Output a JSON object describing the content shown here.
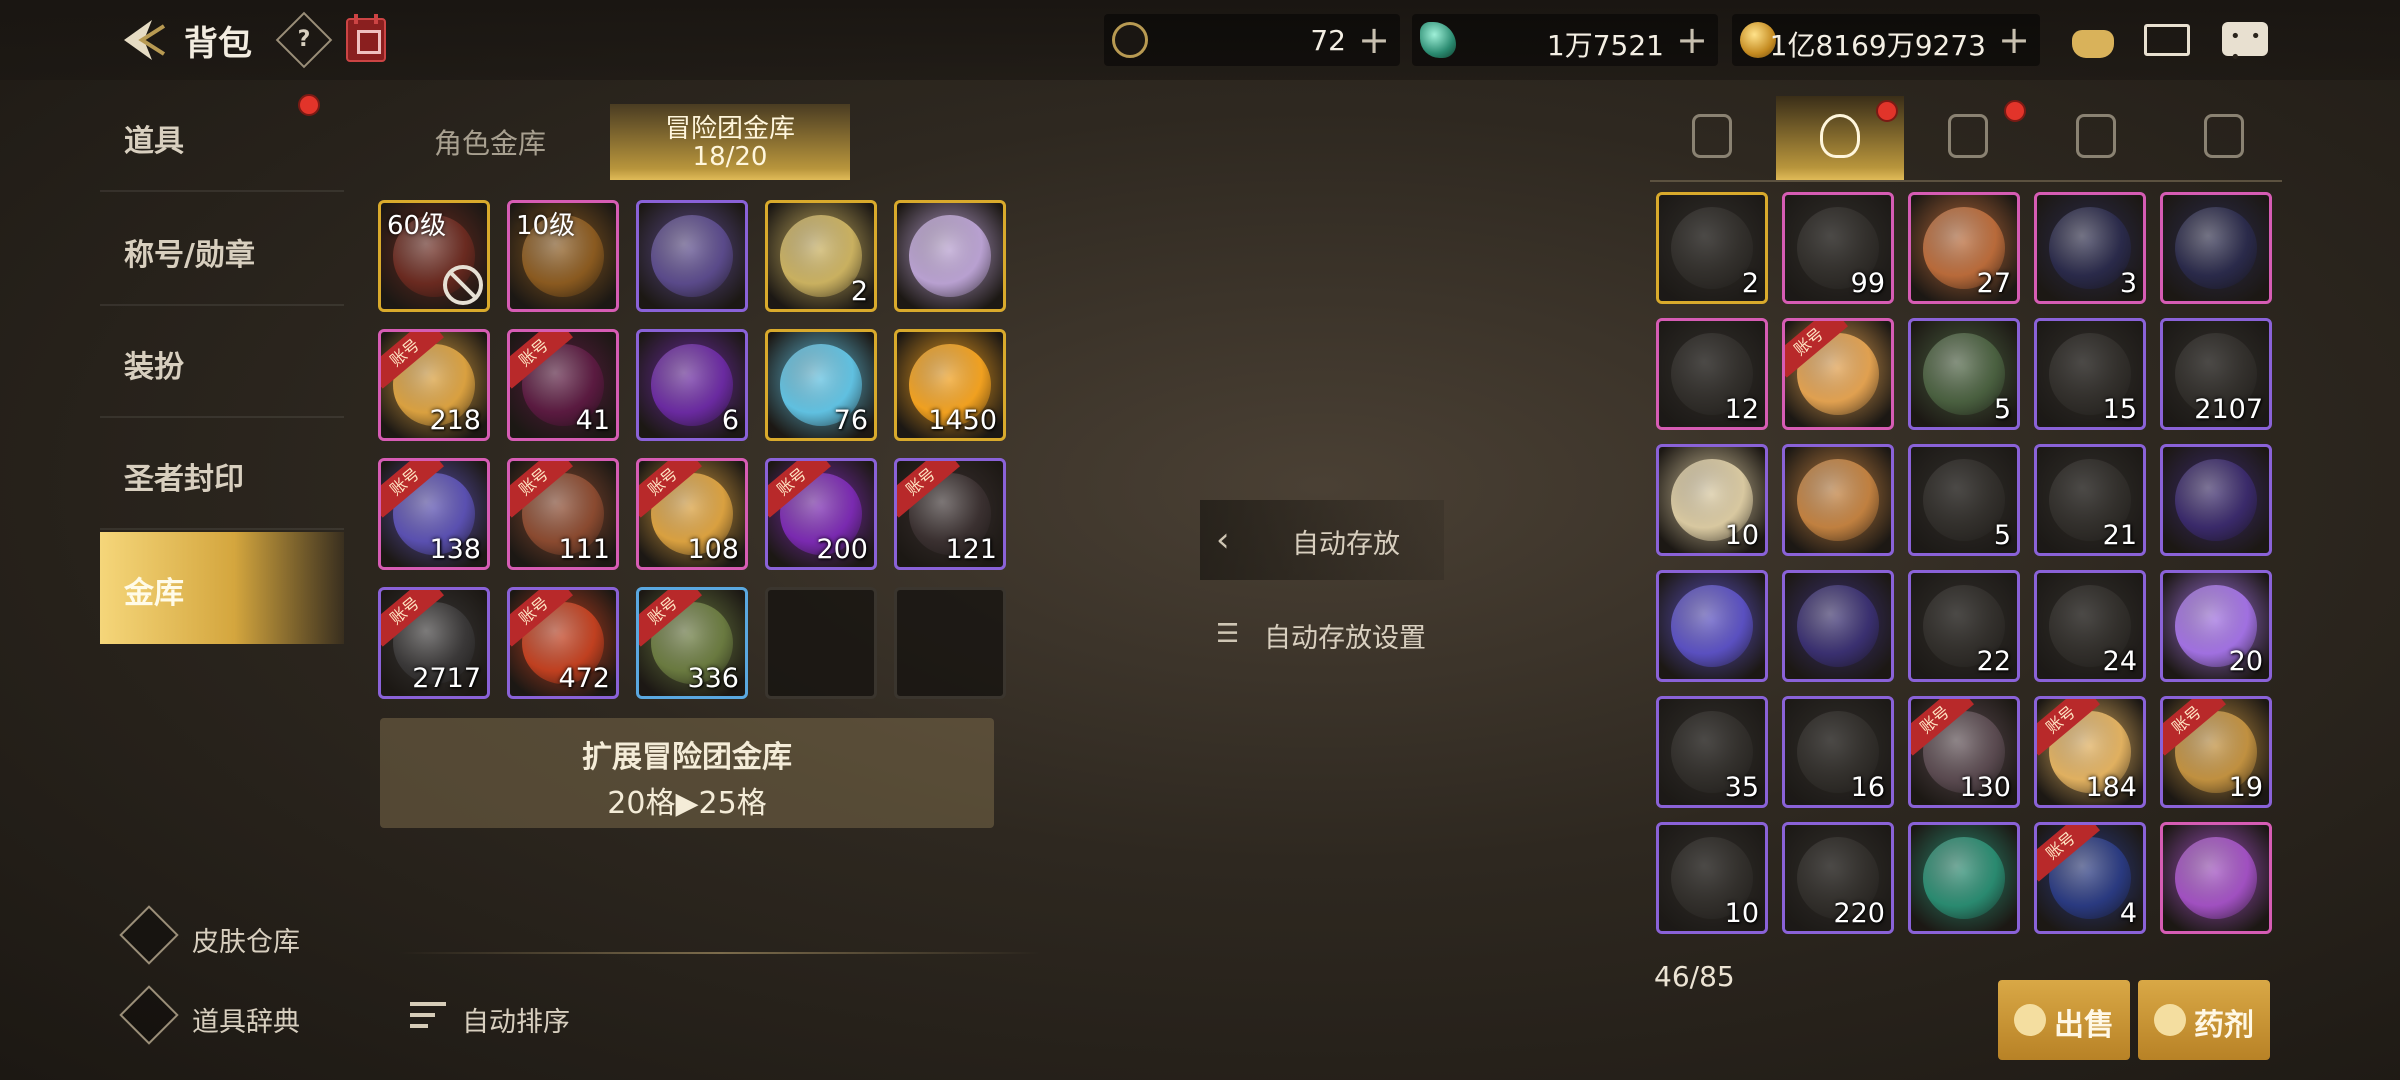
{
  "header": {
    "title": "背包",
    "help": "?"
  },
  "currencies": [
    {
      "icon": "crescent-token-icon",
      "value": "72"
    },
    {
      "icon": "green-gem-icon",
      "value": "1万7521"
    },
    {
      "icon": "gold-coin-icon",
      "value": "1亿8169万9273"
    }
  ],
  "nav": {
    "items": [
      "道具",
      "称号/勋章",
      "装扮",
      "圣者封印",
      "金库"
    ],
    "active": "金库"
  },
  "side_links": {
    "skin": "皮肤仓库",
    "dict": "道具辞典"
  },
  "vault_tabs": {
    "character": "角色金库",
    "team": "冒险团金库",
    "team_count": "18/20"
  },
  "vault_slots": [
    {
      "rarity": "gold",
      "color": "#6a2a20",
      "label": "60级",
      "qty": "",
      "acct": false,
      "locked": true
    },
    {
      "rarity": "pink",
      "color": "#8a5a20",
      "label": "10级",
      "qty": "",
      "acct": false,
      "locked": false
    },
    {
      "rarity": "purple",
      "color": "#5a4a8a",
      "label": "",
      "qty": "",
      "acct": false,
      "locked": false
    },
    {
      "rarity": "gold",
      "color": "#c9b060",
      "label": "",
      "qty": "2",
      "acct": false,
      "locked": false
    },
    {
      "rarity": "gold",
      "color": "#b8a0d0",
      "label": "",
      "qty": "",
      "acct": false,
      "locked": false
    },
    {
      "rarity": "pink",
      "color": "#d9a040",
      "label": "",
      "qty": "218",
      "acct": true,
      "locked": false
    },
    {
      "rarity": "pink",
      "color": "#5a1a40",
      "label": "",
      "qty": "41",
      "acct": true,
      "locked": false
    },
    {
      "rarity": "purple",
      "color": "#6a2aa0",
      "label": "",
      "qty": "6",
      "acct": false,
      "locked": false
    },
    {
      "rarity": "gold",
      "color": "#60c0e0",
      "label": "",
      "qty": "76",
      "acct": false,
      "locked": false
    },
    {
      "rarity": "gold",
      "color": "#f0a020",
      "label": "",
      "qty": "1450",
      "acct": false,
      "locked": false
    },
    {
      "rarity": "pink",
      "color": "#5a50b0",
      "label": "",
      "qty": "138",
      "acct": true,
      "locked": false
    },
    {
      "rarity": "pink",
      "color": "#8a4a30",
      "label": "",
      "qty": "111",
      "acct": true,
      "locked": false
    },
    {
      "rarity": "pink",
      "color": "#d9a040",
      "label": "",
      "qty": "108",
      "acct": true,
      "locked": false
    },
    {
      "rarity": "purple",
      "color": "#7a2ab0",
      "label": "",
      "qty": "200",
      "acct": true,
      "locked": false
    },
    {
      "rarity": "purple",
      "color": "#3a3030",
      "label": "",
      "qty": "121",
      "acct": true,
      "locked": false
    },
    {
      "rarity": "purple",
      "color": "#3a3838",
      "label": "",
      "qty": "2717",
      "acct": true,
      "locked": false
    },
    {
      "rarity": "purple",
      "color": "#c04020",
      "label": "",
      "qty": "472",
      "acct": true,
      "locked": false
    },
    {
      "rarity": "blue",
      "color": "#6a7a40",
      "label": "",
      "qty": "336",
      "acct": true,
      "locked": false
    },
    {
      "rarity": "empty",
      "color": "",
      "label": "",
      "qty": "",
      "acct": false,
      "locked": false
    },
    {
      "rarity": "empty",
      "color": "",
      "label": "",
      "qty": "",
      "acct": false,
      "locked": false
    }
  ],
  "expand": {
    "line1": "扩展冒险团金库",
    "line2": "20格▶25格"
  },
  "auto_sort": "自动排序",
  "auto_store": "自动存放",
  "auto_store_settings": "自动存放设置",
  "inventory_tabs": [
    {
      "icon": "armor-tab-icon",
      "dot": false
    },
    {
      "icon": "potion-tab-icon",
      "dot": true
    },
    {
      "icon": "cubes-tab-icon",
      "dot": true
    },
    {
      "icon": "cards-tab-icon",
      "dot": false
    },
    {
      "icon": "star-emblem-tab-icon",
      "dot": false
    }
  ],
  "inventory_slots": [
    {
      "rarity": "gold",
      "color": "#4a4640",
      "qty": "2",
      "acct": false,
      "dim": true
    },
    {
      "rarity": "pink",
      "color": "#4a4640",
      "qty": "99",
      "acct": false,
      "dim": true
    },
    {
      "rarity": "pink",
      "color": "#b86a3a",
      "qty": "27",
      "acct": false,
      "dim": false
    },
    {
      "rarity": "pink",
      "color": "#2a2a4a",
      "qty": "3",
      "acct": false,
      "dim": false
    },
    {
      "rarity": "pink",
      "color": "#2a2a4a",
      "qty": "",
      "acct": false,
      "dim": false
    },
    {
      "rarity": "pink",
      "color": "#4a4640",
      "qty": "12",
      "acct": false,
      "dim": true
    },
    {
      "rarity": "pink",
      "color": "#e0a050",
      "qty": "",
      "acct": true,
      "dim": false
    },
    {
      "rarity": "purple",
      "color": "#4a6040",
      "qty": "5",
      "acct": false,
      "dim": false
    },
    {
      "rarity": "purple",
      "color": "#4a4640",
      "qty": "15",
      "acct": false,
      "dim": true
    },
    {
      "rarity": "purple",
      "color": "#4a4640",
      "qty": "2107",
      "acct": false,
      "dim": true
    },
    {
      "rarity": "purple",
      "color": "#d8c8a0",
      "qty": "10",
      "acct": false,
      "dim": false
    },
    {
      "rarity": "purple",
      "color": "#c08040",
      "qty": "",
      "acct": false,
      "dim": false
    },
    {
      "rarity": "purple",
      "color": "#4a4640",
      "qty": "5",
      "acct": false,
      "dim": true
    },
    {
      "rarity": "purple",
      "color": "#4a4640",
      "qty": "21",
      "acct": false,
      "dim": true
    },
    {
      "rarity": "purple",
      "color": "#3a2a6a",
      "qty": "",
      "acct": false,
      "dim": false
    },
    {
      "rarity": "purple",
      "color": "#5a50c0",
      "qty": "",
      "acct": false,
      "dim": false
    },
    {
      "rarity": "purple",
      "color": "#3a3070",
      "qty": "",
      "acct": false,
      "dim": false
    },
    {
      "rarity": "purple",
      "color": "#4a4640",
      "qty": "22",
      "acct": false,
      "dim": true
    },
    {
      "rarity": "purple",
      "color": "#4a4640",
      "qty": "24",
      "acct": false,
      "dim": true
    },
    {
      "rarity": "purple",
      "color": "#a070e0",
      "qty": "20",
      "acct": false,
      "dim": false
    },
    {
      "rarity": "purple",
      "color": "#4a4640",
      "qty": "35",
      "acct": false,
      "dim": true
    },
    {
      "rarity": "purple",
      "color": "#4a4640",
      "qty": "16",
      "acct": false,
      "dim": true
    },
    {
      "rarity": "purple",
      "color": "#5a4a50",
      "qty": "130",
      "acct": true,
      "dim": false
    },
    {
      "rarity": "purple",
      "color": "#e0b060",
      "qty": "184",
      "acct": true,
      "dim": false
    },
    {
      "rarity": "purple",
      "color": "#c09040",
      "qty": "19",
      "acct": true,
      "dim": false
    },
    {
      "rarity": "purple",
      "color": "#4a4640",
      "qty": "10",
      "acct": false,
      "dim": true
    },
    {
      "rarity": "purple",
      "color": "#4a4640",
      "qty": "220",
      "acct": false,
      "dim": true
    },
    {
      "rarity": "purple",
      "color": "#2a8a70",
      "qty": "",
      "acct": false,
      "dim": false
    },
    {
      "rarity": "purple",
      "color": "#2a3a80",
      "qty": "4",
      "acct": true,
      "dim": false
    },
    {
      "rarity": "pink",
      "color": "#a050c0",
      "qty": "",
      "acct": false,
      "dim": false
    }
  ],
  "account_tag": "账号",
  "inventory_count": "46/85",
  "actions": {
    "sell": "出售",
    "potion": "药剂"
  }
}
